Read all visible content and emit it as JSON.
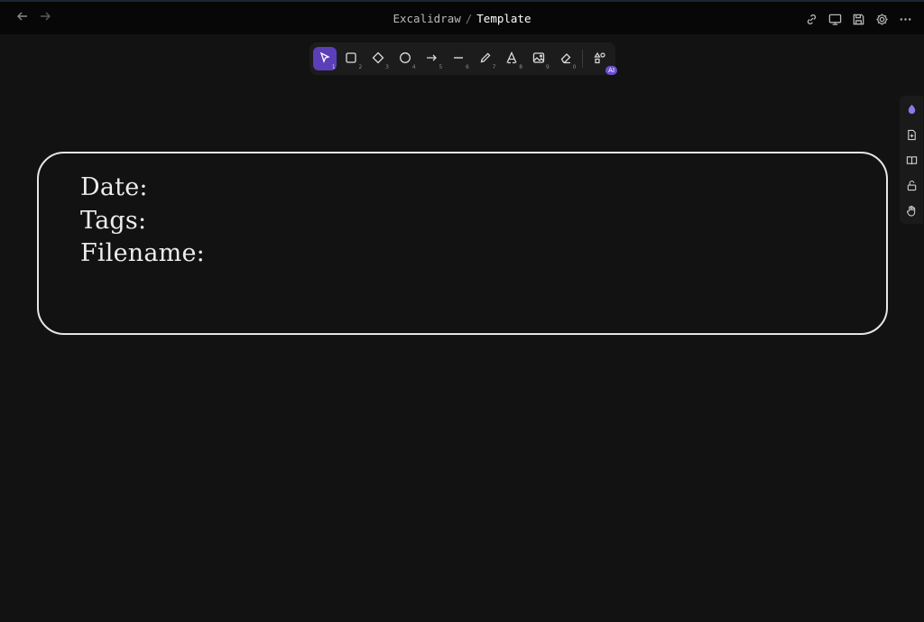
{
  "titlebar": {
    "breadcrumb_parent": "Excalidraw",
    "breadcrumb_sep": "/",
    "breadcrumb_current": "Template",
    "back_icon": "arrow-left-icon",
    "forward_icon": "arrow-right-icon",
    "right_icons": [
      "link-icon",
      "monitor-icon",
      "save-icon",
      "gear-icon",
      "more-icon"
    ]
  },
  "toolbar": {
    "tools": [
      {
        "name": "selection",
        "icon": "cursor-icon",
        "key": "1",
        "active": true
      },
      {
        "name": "rectangle",
        "icon": "square-icon",
        "key": "2"
      },
      {
        "name": "diamond",
        "icon": "diamond-icon",
        "key": "3"
      },
      {
        "name": "ellipse",
        "icon": "circle-icon",
        "key": "4"
      },
      {
        "name": "arrow",
        "icon": "arrow-icon",
        "key": "5"
      },
      {
        "name": "line",
        "icon": "line-icon",
        "key": "6"
      },
      {
        "name": "draw",
        "icon": "pencil-icon",
        "key": "7"
      },
      {
        "name": "text",
        "icon": "text-icon",
        "key": "8"
      },
      {
        "name": "image",
        "icon": "image-icon",
        "key": "9"
      },
      {
        "name": "eraser",
        "icon": "eraser-icon",
        "key": "0"
      }
    ],
    "extra_tool_icon": "shapes-icon",
    "ai_badge": "AI",
    "accent_color": "#5b3fb8"
  },
  "side_panel": {
    "icons": [
      "excalidraw-logo-icon",
      "file-plus-icon",
      "book-icon",
      "unlock-icon",
      "hand-icon"
    ]
  },
  "canvas": {
    "lines": [
      "Date:",
      "Tags:",
      "Filename:"
    ],
    "stroke_color": "#e6e6e6",
    "background": "#121212"
  }
}
